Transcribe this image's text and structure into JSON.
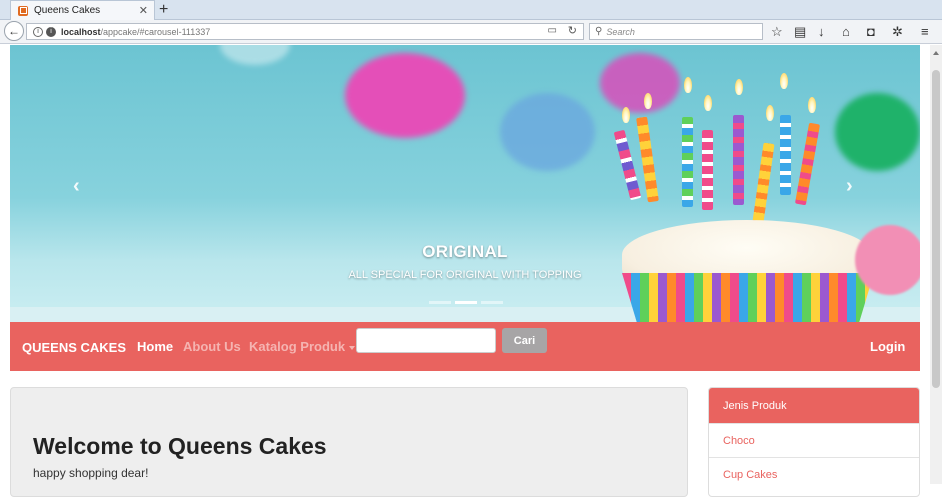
{
  "browser": {
    "tab_title": "Queens Cakes",
    "url_host": "localhost",
    "url_path": "/appcake/#carousel-111337",
    "search_placeholder": "Search"
  },
  "carousel": {
    "caption_title": "ORIGINAL",
    "caption_text": "ALL SPECIAL FOR ORIGINAL WITH TOPPING",
    "slide_count": 3,
    "active_index": 1
  },
  "nav": {
    "brand": "QUEENS CAKES",
    "home": "Home",
    "about": "About Us",
    "katalog": "Katalog Produk",
    "search_value": "",
    "search_button": "Cari",
    "login": "Login"
  },
  "jumbotron": {
    "title": "Welcome to Queens Cakes",
    "subtitle": "happy shopping dear!"
  },
  "sidebar": {
    "heading": "Jenis Produk",
    "items": [
      "Choco",
      "Cup Cakes"
    ]
  },
  "colors": {
    "brand": "#e9635f",
    "brand_muted": "#f5b4b1"
  }
}
